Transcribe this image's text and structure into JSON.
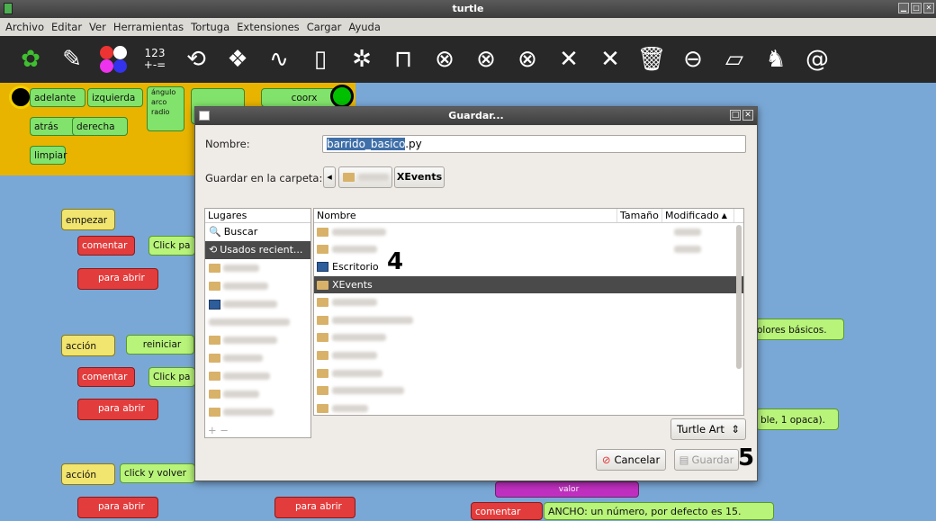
{
  "window": {
    "title": "turtle"
  },
  "menu": [
    "Archivo",
    "Editar",
    "Ver",
    "Herramientas",
    "Tortuga",
    "Extensiones",
    "Cargar",
    "Ayuda"
  ],
  "toolbar": {
    "numbers_label": "123",
    "ops_label": "+-="
  },
  "palette": {
    "blocks": [
      "adelante",
      "izquierda",
      "ángulo",
      "arco",
      "radio",
      "atrás",
      "derecha",
      "limpiar",
      "coorx"
    ]
  },
  "canvas": {
    "empezar": "empezar",
    "comentar1": "comentar",
    "click1": "Click pa",
    "dic1": "para abrir",
    "accion1": "acción",
    "reiniciar": "reiniciar",
    "comentar2": "comentar",
    "click2": "Click pa",
    "dic2": "para abrir",
    "accion2": "acción",
    "clickvolver": "click y volver",
    "dic3": "para abrir",
    "dic4": "para abrir",
    "comentar3": "comentar",
    "colores": "olores básicos.",
    "opaca": "ble, 1 opaca).",
    "ancho": "ANCHO: un número, por defecto es 15.",
    "valor": "valor"
  },
  "dialog": {
    "title": "Guardar...",
    "name_label": "Nombre:",
    "filename_selected": "barrido_basico",
    "filename_ext": ".py",
    "folder_label": "Guardar en la carpeta:",
    "folder_current": "XEvents",
    "places_header": "Lugares",
    "places": [
      "Buscar",
      "Usados recient..."
    ],
    "columns": {
      "name": "Nombre",
      "size": "Tamaño",
      "modified": "Modificado"
    },
    "files": [
      "Escritorio",
      "XEvents"
    ],
    "filter": "Turtle Art",
    "cancel": "Cancelar",
    "save": "Guardar"
  },
  "annotations": {
    "step4": "4",
    "step5": "5"
  }
}
